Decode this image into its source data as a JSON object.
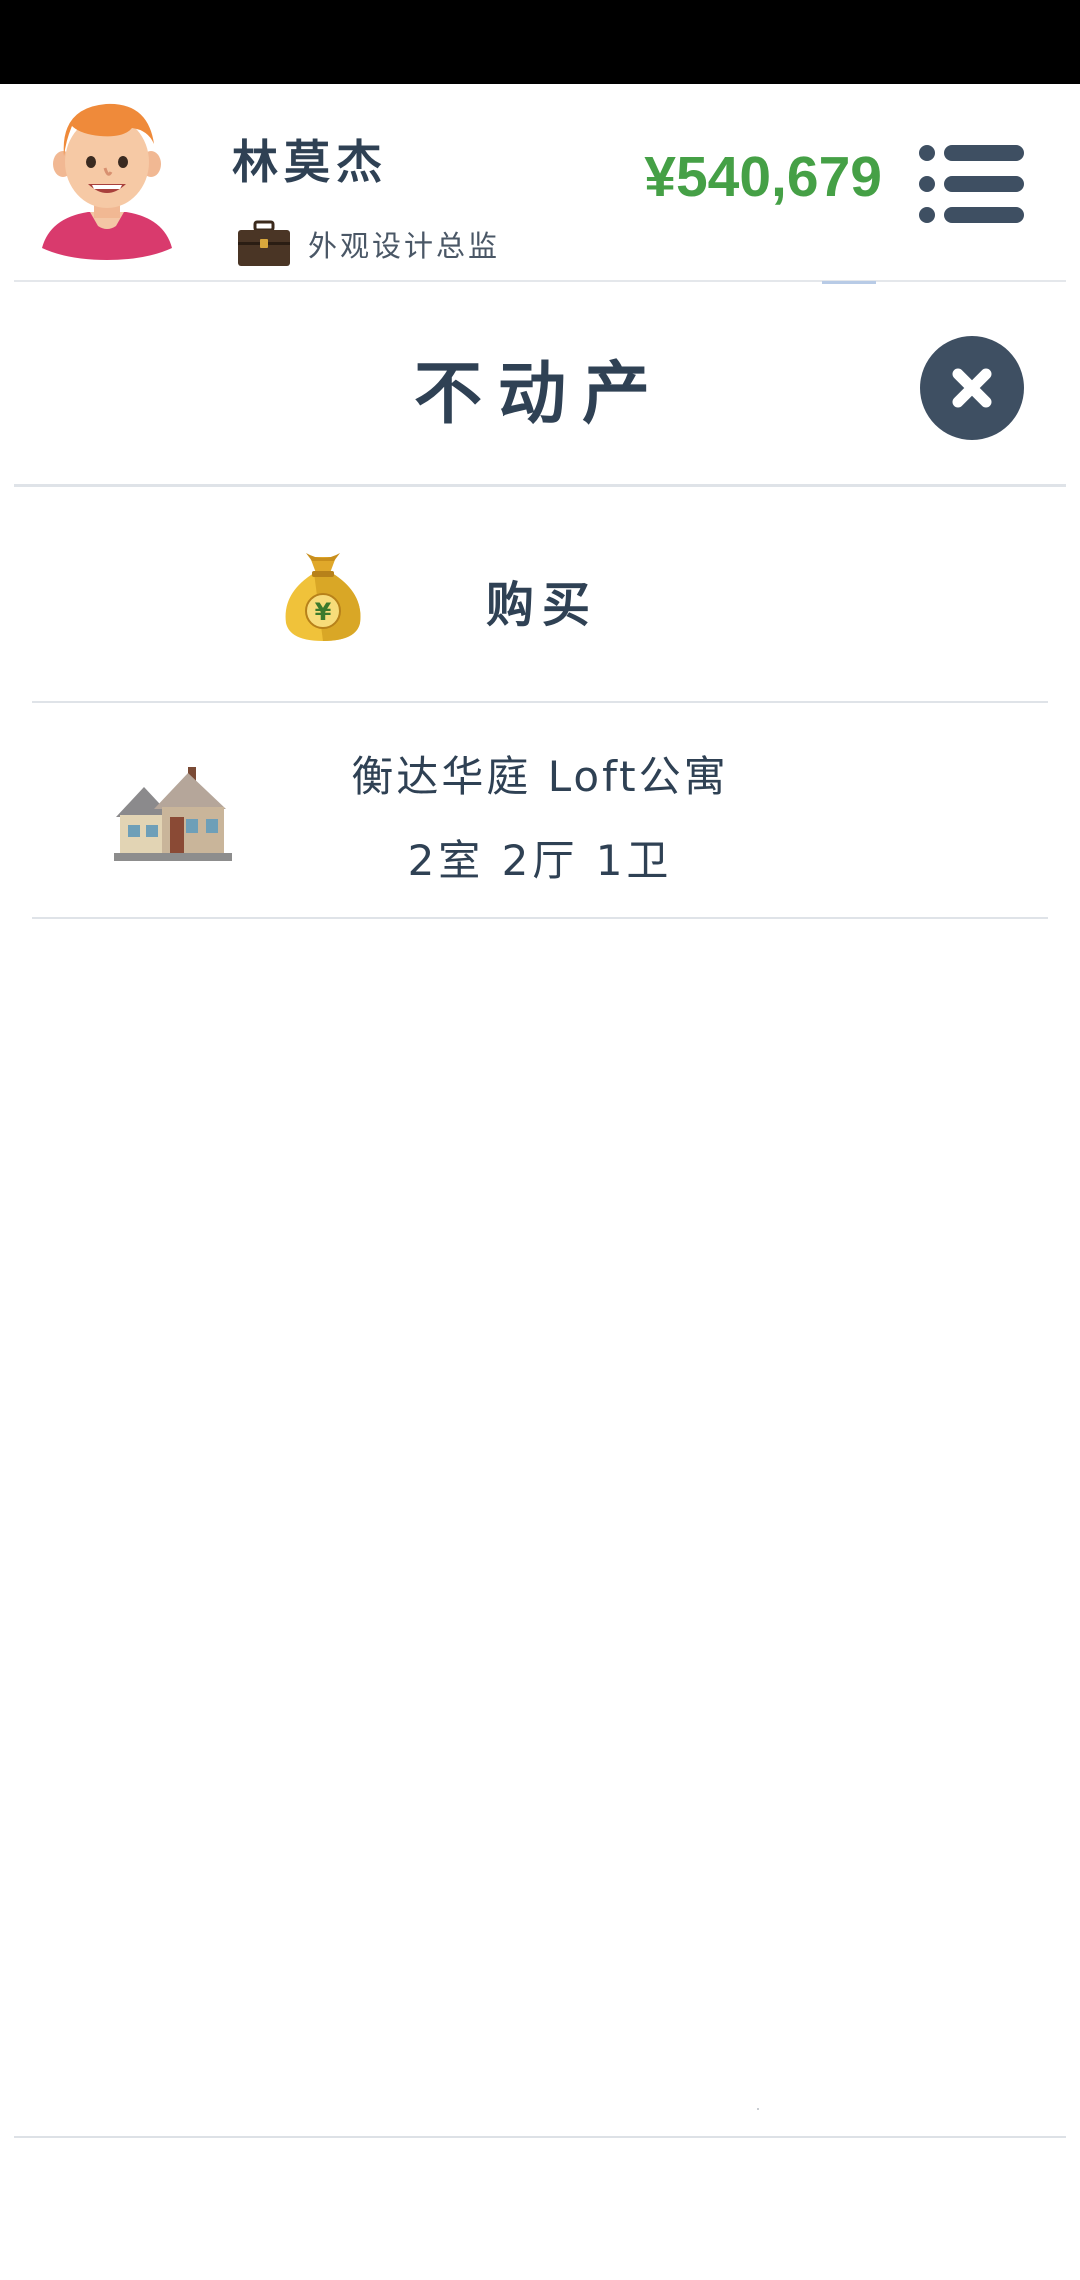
{
  "header": {
    "user_name": "林莫杰",
    "job_title": "外观设计总监",
    "money": "¥540,679",
    "avatar_icon": "boy-avatar-icon",
    "job_icon": "briefcase-icon",
    "menu_icon": "list-menu-icon"
  },
  "page": {
    "title": "不动产",
    "close_icon": "close-icon"
  },
  "buy": {
    "label": "购买",
    "icon": "money-bag-icon"
  },
  "properties": [
    {
      "name": "衡达华庭 Loft公寓",
      "layout": "2室 2厅 1卫",
      "icon": "house-icon"
    }
  ],
  "colors": {
    "money_green": "#45a046",
    "dark_slate": "#2f4154",
    "close_button": "#3e4f62",
    "status_bar": "#000000"
  }
}
